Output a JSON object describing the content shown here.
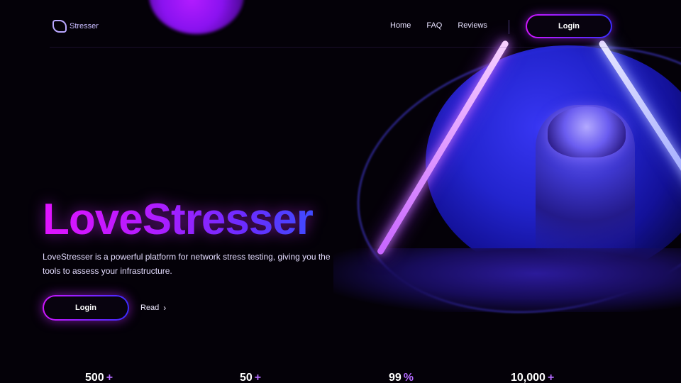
{
  "brand": {
    "logo_text": "Stresser",
    "accent_colors": [
      "#d016ff",
      "#3b2cff"
    ]
  },
  "nav": {
    "links": [
      "Home",
      "FAQ",
      "Reviews"
    ],
    "cta_label": "Login"
  },
  "hero": {
    "title": "LoveStresser",
    "description": "LoveStresser is a powerful platform for network stress testing, giving you the tools to assess your infrastructure.",
    "primary_button": "Login",
    "secondary_link": "Read",
    "secondary_icon": "arrow-right-icon"
  },
  "stats": [
    {
      "value": "500",
      "suffix": "+"
    },
    {
      "value": "50",
      "suffix": "+"
    },
    {
      "value": "99",
      "suffix": "%"
    },
    {
      "value": "10,000",
      "suffix": "+"
    }
  ]
}
